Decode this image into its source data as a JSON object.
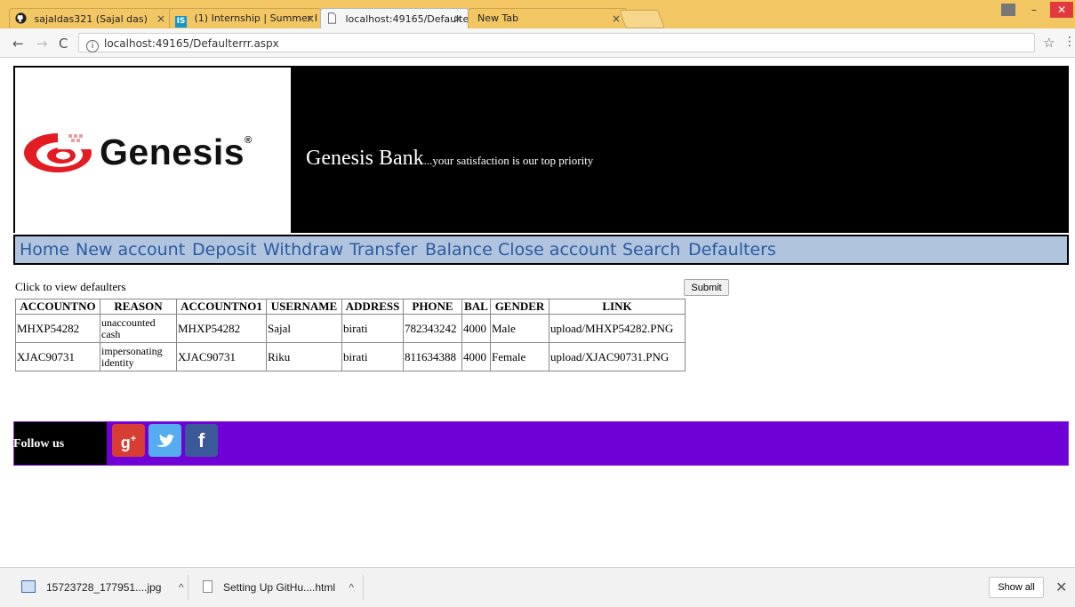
{
  "browser": {
    "tabs": [
      {
        "title": "sajaldas321 (Sajal das)",
        "icon": "github-icon"
      },
      {
        "title": "(1) Internship | Summer I",
        "icon": "internshala-icon"
      },
      {
        "title": "localhost:49165/Defaulte",
        "icon": "page-icon"
      },
      {
        "title": "New Tab",
        "icon": ""
      }
    ],
    "close_glyph": "×",
    "url": "localhost:49165/Defaulterrr.aspx"
  },
  "header": {
    "logo_text": "Genesis",
    "bank_name": "Genesis Bank",
    "slogan": "...your satisfaction is our top priority"
  },
  "menu": [
    "Home",
    "New account",
    "Deposit",
    "Withdraw",
    "Transfer",
    "Balance",
    "Close account",
    "Search",
    "Defaulters"
  ],
  "main": {
    "prompt": "Click to view defaulters",
    "submit_label": "Submit",
    "table": {
      "headers": [
        "ACCOUNTNO",
        "REASON",
        "ACCOUNTNO1",
        "USERNAME",
        "ADDRESS",
        "PHONE",
        "BAL",
        "GENDER",
        "LINK"
      ],
      "rows": [
        [
          "MHXP54282",
          "unaccounted cash",
          "MHXP54282",
          "Sajal",
          "birati",
          "782343242",
          "4000",
          "Male",
          "upload/MHXP54282.PNG"
        ],
        [
          "XJAC90731",
          "impersonating identity",
          "XJAC90731",
          "Riku",
          "birati",
          "811634388",
          "4000",
          "Female",
          "upload/XJAC90731.PNG"
        ]
      ]
    }
  },
  "footer": {
    "follow_label": "Follow us",
    "social": [
      {
        "name": "google-plus-icon",
        "glyph": "g+",
        "color": "#d73d32"
      },
      {
        "name": "twitter-icon",
        "glyph": "t",
        "color": "#55acee"
      },
      {
        "name": "facebook-icon",
        "glyph": "f",
        "color": "#3b5998"
      }
    ]
  },
  "downloads": {
    "items": [
      "15723728_177951....jpg",
      "Setting Up GitHu....html"
    ],
    "show_all": "Show all"
  },
  "colors": {
    "menu_bg": "#b0c4de",
    "menu_link": "#2c5aa0",
    "footer_bg": "#6f00d6",
    "tabstrip": "#f3c664"
  }
}
